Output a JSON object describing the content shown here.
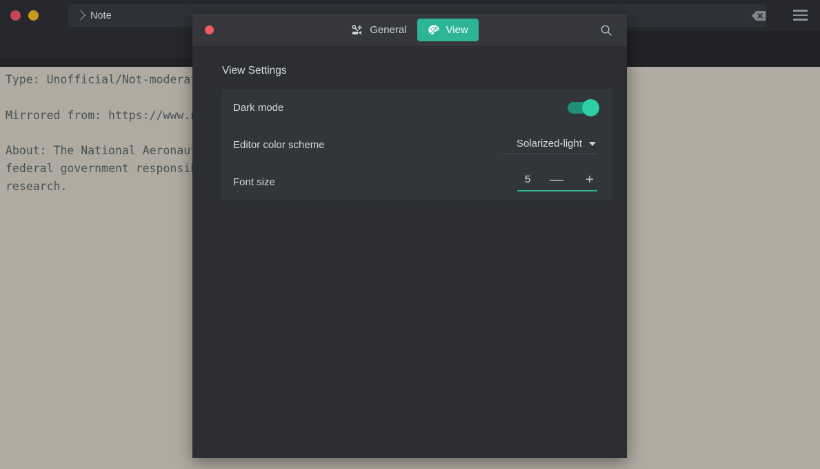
{
  "app_window": {
    "titlebar": {
      "traffic_lights": [
        {
          "name": "close",
          "color": "#c0485a"
        },
        {
          "name": "minimize",
          "color": "#c79a1c"
        }
      ],
      "breadcrumb": {
        "separator_icon": "chevron-right-icon",
        "label": "Note"
      },
      "backspace_icon": "backspace-delete-icon",
      "menu_icon": "hamburger-menu-icon"
    },
    "editor": {
      "color_scheme_background": "#b0aaa0",
      "text_color": "#465257",
      "content": "Type: Unofficial/Not-moderated\n\nMirrored from: https://www.nasa.gov\n\nAbout: The National Aeronautics and Space Administration is an agency of the U.S.\nfederal government responsible for the civil space program, aeronautics and space\nresearch."
    }
  },
  "settings_dialog": {
    "close_button_color": "#ef5b5f",
    "accent_color": "#2db596",
    "tabs": [
      {
        "id": "general",
        "label": "General",
        "icon": "tools-wrench-icon",
        "active": false
      },
      {
        "id": "view",
        "label": "View",
        "icon": "palette-icon",
        "active": true
      }
    ],
    "search_icon": "search-icon",
    "section_title": "View Settings",
    "settings": [
      {
        "id": "dark-mode",
        "label": "Dark mode",
        "control": "toggle",
        "value": "on"
      },
      {
        "id": "editor-color-scheme",
        "label": "Editor color scheme",
        "control": "dropdown",
        "value": "Solarized-light",
        "caret_icon": "chevron-down-icon"
      },
      {
        "id": "font-size",
        "label": "Font size",
        "control": "stepper",
        "value": "5",
        "decrement_label": "—",
        "increment_label": "+"
      }
    ]
  }
}
